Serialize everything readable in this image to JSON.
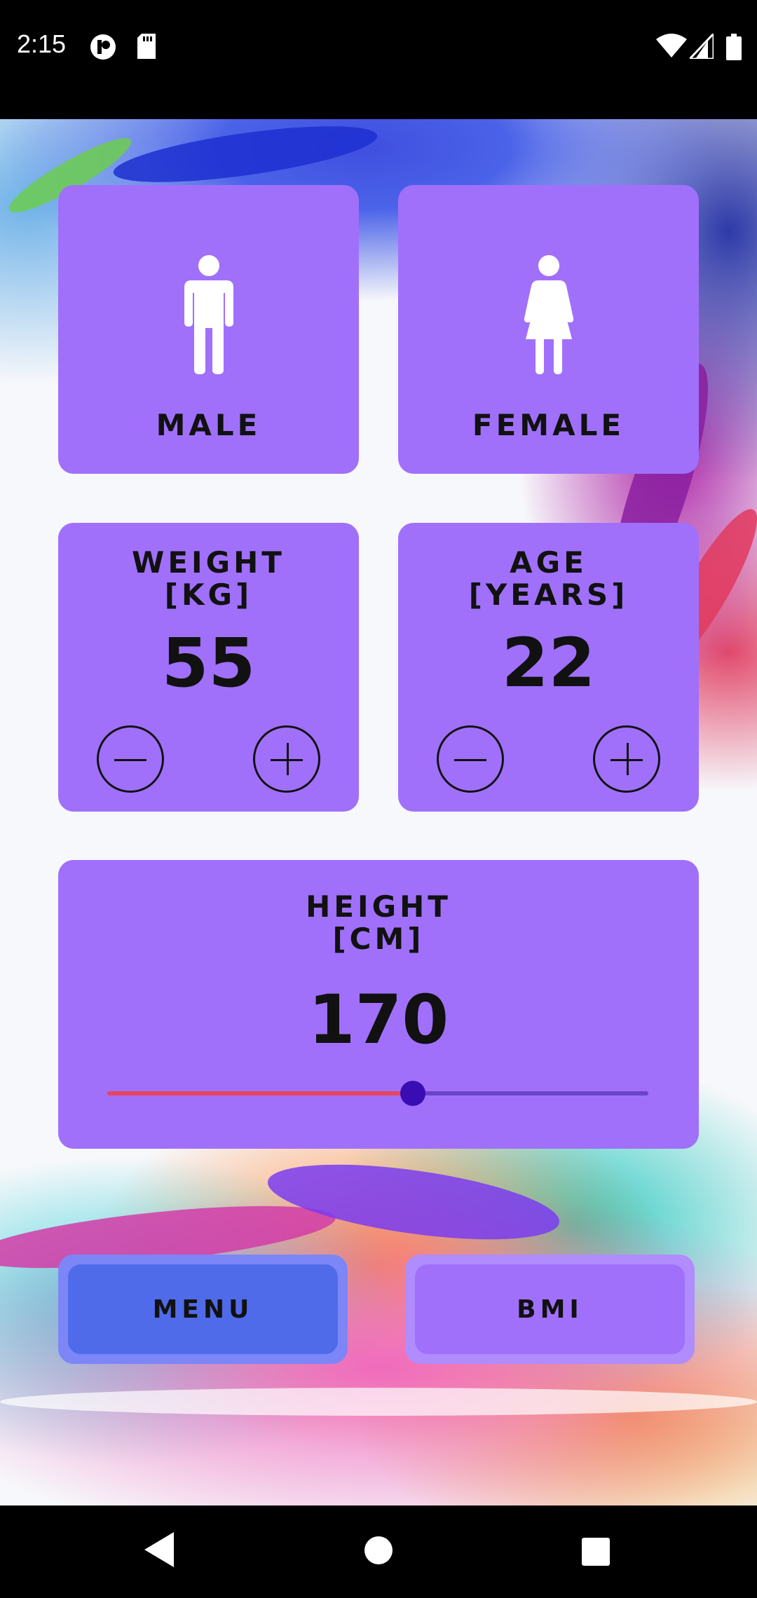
{
  "status_bar": {
    "time": "2:15",
    "icons": [
      "app-notification-icon",
      "sd-card-icon",
      "wifi-icon",
      "cell-signal-icon",
      "battery-icon"
    ]
  },
  "gender": {
    "male_label": "MALE",
    "female_label": "FEMALE"
  },
  "weight": {
    "label": "WEIGHT\n[KG]",
    "value": "55"
  },
  "age": {
    "label": "AGE\n[YEARS]",
    "value": "22"
  },
  "height": {
    "label": "HEIGHT\n[CM]",
    "value": "170",
    "slider_fraction": 0.565
  },
  "buttons": {
    "menu_label": "MENU",
    "bmi_label": "BMI"
  },
  "colors": {
    "card": "#a070fb",
    "menu_outer": "#7d86f6",
    "menu_inner": "#4f6bea",
    "bmi_outer": "#b08cfc",
    "bmi_inner": "#a070fb",
    "slider_active": "#e8455c",
    "slider_thumb": "#3a0db4"
  },
  "nav_bar": {
    "icons": [
      "back-icon",
      "home-icon",
      "recents-icon"
    ]
  }
}
